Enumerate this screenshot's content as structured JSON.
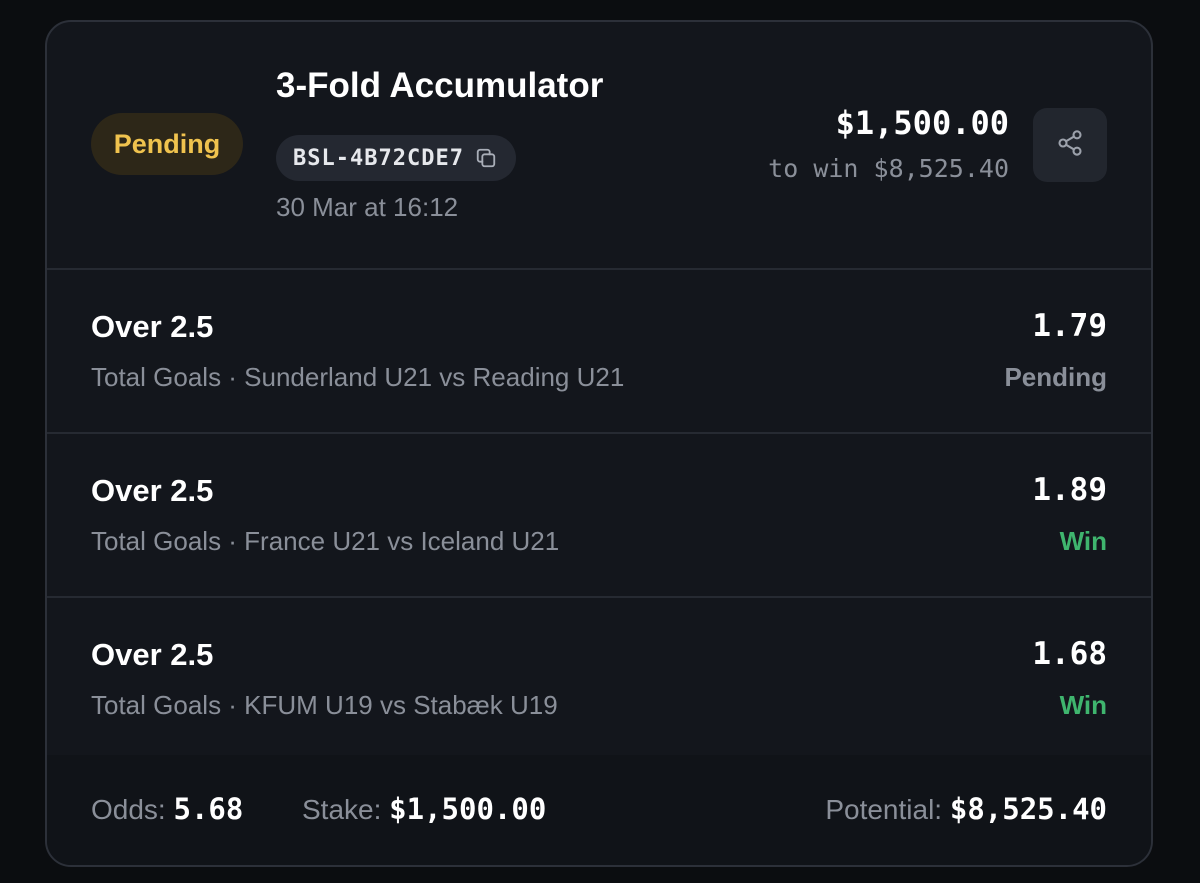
{
  "bet": {
    "status": "Pending",
    "title": "3-Fold Accumulator",
    "code": "BSL-4B72CDE7",
    "date": "30 Mar at 16:12",
    "stake": "$1,500.00",
    "to_win": "to win $8,525.40"
  },
  "icons": {
    "copy": "copy-icon",
    "share": "share-icon"
  },
  "legs": [
    {
      "selection": "Over 2.5",
      "description": "Total Goals · Sunderland U21 vs Reading U21",
      "odds": "1.79",
      "status": "Pending",
      "status_color": "#8a8f99"
    },
    {
      "selection": "Over 2.5",
      "description": "Total Goals · France U21 vs Iceland U21",
      "odds": "1.89",
      "status": "Win",
      "status_color": "#3fb56e"
    },
    {
      "selection": "Over 2.5",
      "description": "Total Goals · KFUM U19 vs Stabæk U19",
      "odds": "1.68",
      "status": "Win",
      "status_color": "#3fb56e"
    }
  ],
  "footer": {
    "odds_label": "Odds:",
    "odds_value": "5.68",
    "stake_label": "Stake:",
    "stake_value": "$1,500.00",
    "potential_label": "Potential:",
    "potential_value": "$8,525.40"
  },
  "colors": {
    "pending_badge_text": "#f0c34e",
    "pending_badge_bg": "#2d2718",
    "win": "#3fb56e",
    "card_bg": "#13161c"
  }
}
